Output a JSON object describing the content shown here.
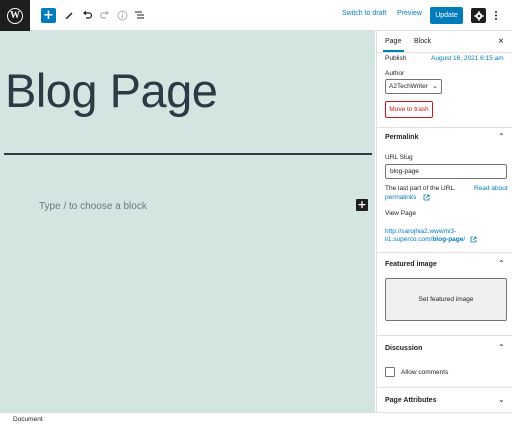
{
  "toolbar": {
    "switch_to_draft": "Switch to draft",
    "preview": "Preview",
    "update": "Update",
    "add_symbol": "+",
    "logo_letter": "W"
  },
  "canvas": {
    "title": "Blog Page",
    "block_placeholder": "Type / to choose a block",
    "inserter_symbol": "+"
  },
  "sidebar": {
    "tabs": [
      {
        "label": "Page",
        "active": true
      },
      {
        "label": "Block",
        "active": false
      }
    ],
    "close_symbol": "×",
    "publish_label": "Publish",
    "publish_date": "August 16, 2021 6:15 am",
    "author_label": "Author",
    "author_value": "A2TechWriter",
    "move_to_trash": "Move to trash",
    "permalink": {
      "title": "Permalink",
      "url_slug_label": "URL Slug",
      "url_slug_value": "blog-page",
      "help_text": "The last part of the URL.",
      "read_about": "Read about",
      "permalinks": "permalinks",
      "view_page_label": "View Page",
      "view_url_line1": "http://sarojhia2.wwwmi3-",
      "view_url_line2a": "li1.superco.com/",
      "view_url_line2b": "blog-page",
      "view_url_line2c": "/"
    },
    "featured_image": {
      "title": "Featured image",
      "set_button": "Set featured image"
    },
    "discussion": {
      "title": "Discussion",
      "allow_comments": "Allow comments",
      "allow_comments_checked": false
    },
    "page_attributes": {
      "title": "Page Attributes"
    }
  },
  "footer": {
    "breadcrumb": "Document"
  },
  "colors": {
    "accent": "#007cba",
    "canvas_bg": "#d3e5e0",
    "title_text": "#2c3a46",
    "danger": "#cc1818",
    "dark": "#1e1e1e"
  },
  "icons": {
    "pen": "pen-icon",
    "undo": "undo-icon",
    "redo": "redo-icon",
    "info": "info-icon",
    "list_view": "list-view-icon",
    "settings": "gear-icon",
    "more": "vertical-ellipsis-icon",
    "external": "external-link-icon"
  }
}
